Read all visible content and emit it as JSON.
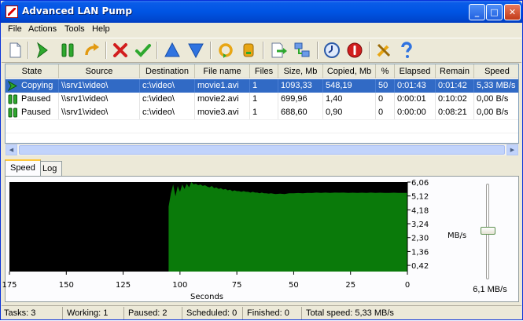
{
  "window": {
    "title": "Advanced LAN Pump"
  },
  "menu": {
    "file": "File",
    "actions": "Actions",
    "tools": "Tools",
    "help": "Help"
  },
  "toolbar_icons": [
    "new-icon",
    "start-icon",
    "pause-icon",
    "redo-icon",
    "delete-icon",
    "accept-icon",
    "move-up-icon",
    "move-down-icon",
    "refresh-icon",
    "map-drive-icon",
    "export-icon",
    "network-icon",
    "schedule-icon",
    "stop-icon",
    "settings-icon",
    "help-icon"
  ],
  "table": {
    "columns": [
      "State",
      "Source",
      "Destination",
      "File name",
      "Files",
      "Size, Mb",
      "Copied, Mb",
      "%",
      "Elapsed",
      "Remain",
      "Speed"
    ],
    "rows": [
      {
        "state": "Copying",
        "source": "\\\\srv1\\video\\",
        "destination": "c:\\video\\",
        "file": "movie1.avi",
        "files": "1",
        "size": "1093,33",
        "copied": "548,19",
        "percent": "50",
        "elapsed": "0:01:43",
        "remain": "0:01:42",
        "speed": "5,33 MB/s"
      },
      {
        "state": "Paused",
        "source": "\\\\srv1\\video\\",
        "destination": "c:\\video\\",
        "file": "movie2.avi",
        "files": "1",
        "size": "699,96",
        "copied": "1,40",
        "percent": "0",
        "elapsed": "0:00:01",
        "remain": "0:10:02",
        "speed": "0,00 B/s"
      },
      {
        "state": "Paused",
        "source": "\\\\srv1\\video\\",
        "destination": "c:\\video\\",
        "file": "movie3.avi",
        "files": "1",
        "size": "688,60",
        "copied": "0,90",
        "percent": "0",
        "elapsed": "0:00:00",
        "remain": "0:08:21",
        "speed": "0,00 B/s"
      }
    ]
  },
  "tabs": {
    "speed": "Speed",
    "log": "Log"
  },
  "chart_data": {
    "type": "area",
    "xlabel": "Seconds",
    "ylabel": "MB/s",
    "x_ticks": [
      "175",
      "150",
      "125",
      "100",
      "75",
      "50",
      "25",
      "0"
    ],
    "y_ticks": [
      "6,06",
      "5,12",
      "4,18",
      "3,24",
      "2,30",
      "1,36",
      "0,42"
    ],
    "xlim": [
      175,
      0
    ],
    "ylim": [
      0,
      6.06
    ],
    "x": [
      105,
      104,
      103,
      102,
      101,
      100,
      99,
      98,
      97,
      96,
      95,
      94,
      93,
      92,
      91,
      90,
      89,
      88,
      87,
      86,
      85,
      84,
      83,
      82,
      81,
      80,
      79,
      78,
      77,
      76,
      75,
      74,
      73,
      72,
      71,
      70,
      69,
      68,
      67,
      66,
      65,
      64,
      63,
      62,
      61,
      60,
      58,
      56,
      54,
      52,
      50,
      48,
      46,
      44,
      42,
      40,
      38,
      36,
      34,
      32,
      30,
      28,
      26,
      24,
      22,
      20,
      18,
      16,
      14,
      12,
      10,
      8,
      6,
      4,
      2,
      0
    ],
    "values": [
      4.4,
      5.3,
      5.9,
      5.1,
      5.8,
      5.4,
      5.9,
      5.6,
      5.95,
      5.7,
      6.06,
      5.9,
      5.95,
      5.85,
      5.9,
      5.8,
      5.85,
      5.75,
      5.7,
      5.8,
      5.65,
      5.7,
      5.6,
      5.65,
      5.55,
      5.6,
      5.5,
      5.55,
      5.45,
      5.5,
      5.45,
      5.45,
      5.4,
      5.45,
      5.4,
      5.4,
      5.35,
      5.4,
      5.35,
      5.35,
      5.3,
      5.35,
      5.3,
      5.3,
      5.28,
      5.3,
      5.25,
      5.28,
      5.25,
      5.3,
      5.3,
      5.32,
      5.3,
      5.33,
      5.32,
      5.35,
      5.33,
      5.35,
      5.33,
      5.35,
      5.34,
      5.35,
      5.33,
      5.34,
      5.33,
      5.34,
      5.33,
      5.35,
      5.33,
      5.34,
      5.33,
      5.33,
      5.34,
      5.33,
      5.33,
      5.33
    ],
    "color": "#0a7a0a",
    "background": "#000000"
  },
  "slider": {
    "value_label": "6,1 MB/s",
    "level_fraction": 0.5
  },
  "status": {
    "tasks": "Tasks: 3",
    "working": "Working: 1",
    "paused": "Paused: 2",
    "scheduled": "Scheduled: 0",
    "finished": "Finished: 0",
    "total_speed": "Total speed: 5,33 MB/s"
  }
}
